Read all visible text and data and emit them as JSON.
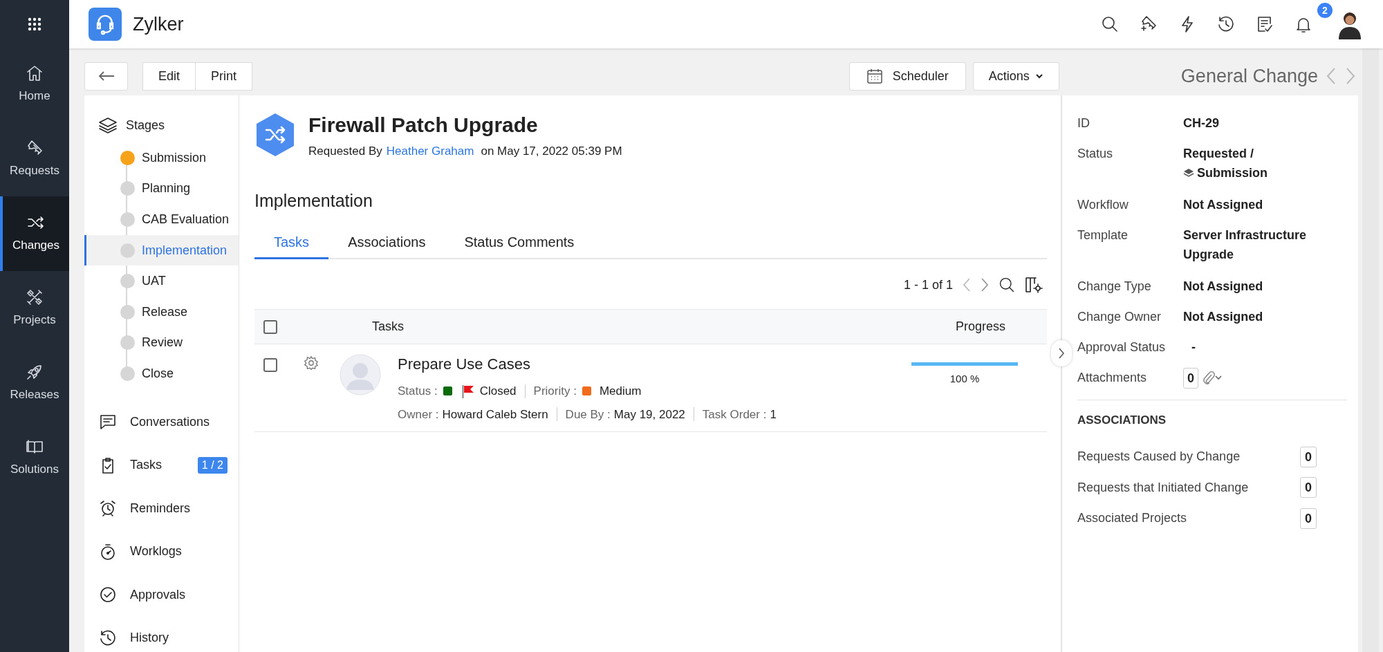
{
  "app_grid_button": {
    "kind": "grid"
  },
  "nav": [
    {
      "label": "Home",
      "selected": false
    },
    {
      "label": "Requests",
      "selected": false
    },
    {
      "label": "Changes",
      "selected": true
    },
    {
      "label": "Projects",
      "selected": false
    },
    {
      "label": "Releases",
      "selected": false
    },
    {
      "label": "Solutions",
      "selected": false
    }
  ],
  "brand": {
    "name": "Zylker"
  },
  "header_actions": {
    "notifications_count": "2"
  },
  "toolbar": {
    "buttons": [
      "Edit",
      "Print"
    ],
    "scheduler": "Scheduler",
    "actions": "Actions"
  },
  "record_type": "General Change",
  "stages": {
    "title": "Stages",
    "items": [
      {
        "label": "Submission",
        "active": true,
        "selected": false
      },
      {
        "label": "Planning",
        "active": false,
        "selected": false
      },
      {
        "label": "CAB Evaluation",
        "active": false,
        "selected": false
      },
      {
        "label": "Implementation",
        "active": false,
        "selected": true
      },
      {
        "label": "UAT",
        "active": false,
        "selected": false
      },
      {
        "label": "Release",
        "active": false,
        "selected": false
      },
      {
        "label": "Review",
        "active": false,
        "selected": false
      },
      {
        "label": "Close",
        "active": false,
        "selected": false
      }
    ]
  },
  "sections": [
    {
      "label": "Conversations"
    },
    {
      "label": "Tasks",
      "badge": "1 / 2"
    },
    {
      "label": "Reminders"
    },
    {
      "label": "Worklogs"
    },
    {
      "label": "Approvals"
    },
    {
      "label": "History"
    }
  ],
  "change": {
    "title": "Firewall Patch Upgrade",
    "requested_by_label": "Requested By",
    "requester": "Heather Graham",
    "requested_on": "on May 17, 2022 05:39 PM"
  },
  "stage_heading": "Implementation",
  "tabs": [
    {
      "label": "Tasks",
      "selected": true
    },
    {
      "label": "Associations",
      "selected": false
    },
    {
      "label": "Status Comments",
      "selected": false
    }
  ],
  "pagination": "1 - 1 of 1",
  "table": {
    "columns": [
      "Tasks",
      "Progress"
    ],
    "header_checked": false,
    "rows": [
      {
        "checked": false,
        "name": "Prepare Use Cases",
        "status": {
          "label": "Status :",
          "color": "#0b6b0b",
          "value": "Closed"
        },
        "priority": {
          "label": "Priority :",
          "color": "#f26a1b",
          "value": "Medium"
        },
        "owner_label": "Owner :",
        "owner": "Howard Caleb Stern",
        "due_label": "Due By :",
        "due": "May 19, 2022",
        "order_label": "Task Order :",
        "order": "1",
        "level": 1,
        "progress_text": "100 %"
      }
    ]
  },
  "details": [
    {
      "label": "ID",
      "value": "CH-29"
    },
    {
      "label": "Status",
      "value": "Requested /",
      "stage": "Submission"
    },
    {
      "label": "Workflow",
      "value": "Not Assigned"
    },
    {
      "label": "Template",
      "value": "Server Infrastructure Upgrade"
    },
    {
      "label": "Change Type",
      "value": "Not Assigned"
    },
    {
      "label": "Change Owner",
      "value": "Not Assigned"
    },
    {
      "label": "Approval Status",
      "value": "-"
    },
    {
      "label": "Attachments",
      "count": "0"
    }
  ],
  "associations": {
    "title": "ASSOCIATIONS",
    "items": [
      {
        "label": "Requests Caused by Change",
        "count": "0"
      },
      {
        "label": "Requests that Initiated Change",
        "count": "0"
      },
      {
        "label": "Associated Projects",
        "count": "0"
      }
    ]
  }
}
